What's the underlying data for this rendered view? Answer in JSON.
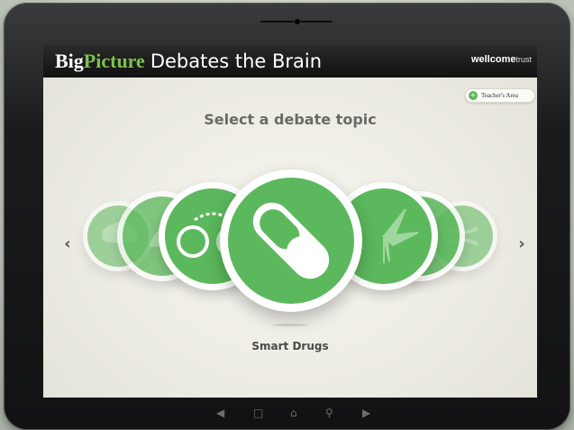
{
  "app": {
    "brand_big": "Big",
    "brand_picture": "Picture",
    "brand_rest": "Debates the Brain",
    "sponsor_name": "wellcome",
    "sponsor_suffix": "trust"
  },
  "teacher_area": {
    "label": "Teacher's Area",
    "icon": "plus-circle-icon"
  },
  "heading": "Select a debate topic",
  "carousel": {
    "selected_caption": "Smart Drugs",
    "items": [
      {
        "icon": "brain-icon"
      },
      {
        "icon": "animal-testing-icon"
      },
      {
        "icon": "handcuffs-icon"
      },
      {
        "icon": "pill-capsule-icon",
        "selected": true
      },
      {
        "icon": "cannabis-leaf-icon"
      },
      {
        "icon": "hand-icon"
      },
      {
        "icon": "gene-icon"
      }
    ],
    "prev_icon": "chevron-left-icon",
    "next_icon": "chevron-right-icon"
  },
  "device_nav": {
    "back_icon": "back-arrow-icon",
    "recents_icon": "recent-apps-icon",
    "home_icon": "home-icon",
    "search_icon": "search-icon",
    "menu_icon": "play-arrow-icon"
  },
  "colors": {
    "accent": "#5cb85c",
    "brand_green": "#7cc34a",
    "appbar": "#111111"
  }
}
